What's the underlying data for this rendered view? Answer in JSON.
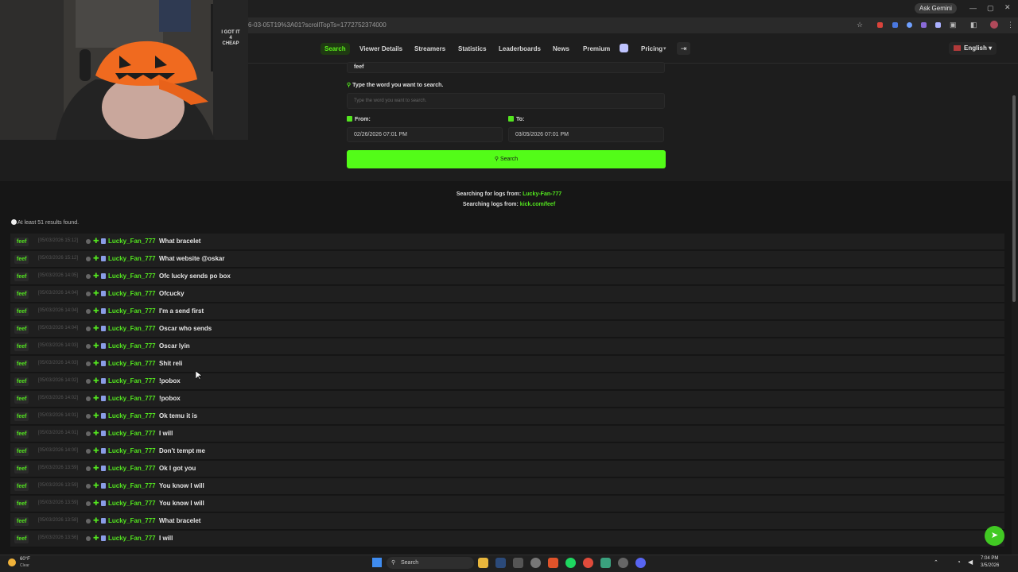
{
  "browser": {
    "url": "6-03-05T19%3A01?scrollTopTs=1772752374000",
    "ask_gemini": "Ask Gemini"
  },
  "webcam": {
    "shirt_text": "I GOT IT 4 CHEAP"
  },
  "nav": {
    "items": [
      "Search",
      "Viewer Details",
      "Streamers",
      "Statistics",
      "Leaderboards",
      "News",
      "Premium",
      "Pricing"
    ],
    "language": "English"
  },
  "form": {
    "channel_value": "feef",
    "word_label": "Type the word you want to search.",
    "word_placeholder": "Type the word you want to search.",
    "from_label": "From:",
    "from_value": "02/26/2026 07:01 PM",
    "to_label": "To:",
    "to_value": "03/05/2026 07:01 PM",
    "search_button": "Search"
  },
  "results": {
    "searching_user_prefix": "Searching for logs from:",
    "searching_user": "Lucky-Fan-777",
    "searching_channel_prefix": "Searching logs from:",
    "searching_channel": "kick.com/feef",
    "count_text": "At least 51 results found.",
    "rows": [
      {
        "channel": "feef",
        "time": "[05/03/2026 15:12]",
        "user": "Lucky_Fan_777",
        "message": "What bracelet"
      },
      {
        "channel": "feef",
        "time": "[05/03/2026 15:12]",
        "user": "Lucky_Fan_777",
        "message": "What website @oskar"
      },
      {
        "channel": "feef",
        "time": "[05/03/2026 14:05]",
        "user": "Lucky_Fan_777",
        "message": "Ofc lucky sends po box"
      },
      {
        "channel": "feef",
        "time": "[05/03/2026 14:04]",
        "user": "Lucky_Fan_777",
        "message": "Ofcucky"
      },
      {
        "channel": "feef",
        "time": "[05/03/2026 14:04]",
        "user": "Lucky_Fan_777",
        "message": "I'm a send first"
      },
      {
        "channel": "feef",
        "time": "[05/03/2026 14:04]",
        "user": "Lucky_Fan_777",
        "message": "Oscar who sends"
      },
      {
        "channel": "feef",
        "time": "[05/03/2026 14:03]",
        "user": "Lucky_Fan_777",
        "message": "Oscar lyin"
      },
      {
        "channel": "feef",
        "time": "[05/03/2026 14:03]",
        "user": "Lucky_Fan_777",
        "message": "Shit reli"
      },
      {
        "channel": "feef",
        "time": "[05/03/2026 14:02]",
        "user": "Lucky_Fan_777",
        "message": "!pobox"
      },
      {
        "channel": "feef",
        "time": "[05/03/2026 14:02]",
        "user": "Lucky_Fan_777",
        "message": "!pobox"
      },
      {
        "channel": "feef",
        "time": "[05/03/2026 14:01]",
        "user": "Lucky_Fan_777",
        "message": "Ok temu it is"
      },
      {
        "channel": "feef",
        "time": "[05/03/2026 14:01]",
        "user": "Lucky_Fan_777",
        "message": "I will"
      },
      {
        "channel": "feef",
        "time": "[05/03/2026 14:00]",
        "user": "Lucky_Fan_777",
        "message": "Don't tempt me"
      },
      {
        "channel": "feef",
        "time": "[05/03/2026 13:59]",
        "user": "Lucky_Fan_777",
        "message": "Ok I got you"
      },
      {
        "channel": "feef",
        "time": "[05/03/2026 13:59]",
        "user": "Lucky_Fan_777",
        "message": "You know I will"
      },
      {
        "channel": "feef",
        "time": "[05/03/2026 13:59]",
        "user": "Lucky_Fan_777",
        "message": "You know I will"
      },
      {
        "channel": "feef",
        "time": "[05/03/2026 13:58]",
        "user": "Lucky_Fan_777",
        "message": "What bracelet"
      },
      {
        "channel": "feef",
        "time": "[05/03/2026 13:56]",
        "user": "Lucky_Fan_777",
        "message": "I will"
      }
    ]
  },
  "taskbar": {
    "weather_temp": "60°F",
    "weather_desc": "Clear",
    "search_label": "Search",
    "time": "7:04 PM",
    "date": "3/5/2026"
  },
  "colors": {
    "accent": "#53fc18",
    "username": "#53e51f",
    "background": "#161616"
  }
}
